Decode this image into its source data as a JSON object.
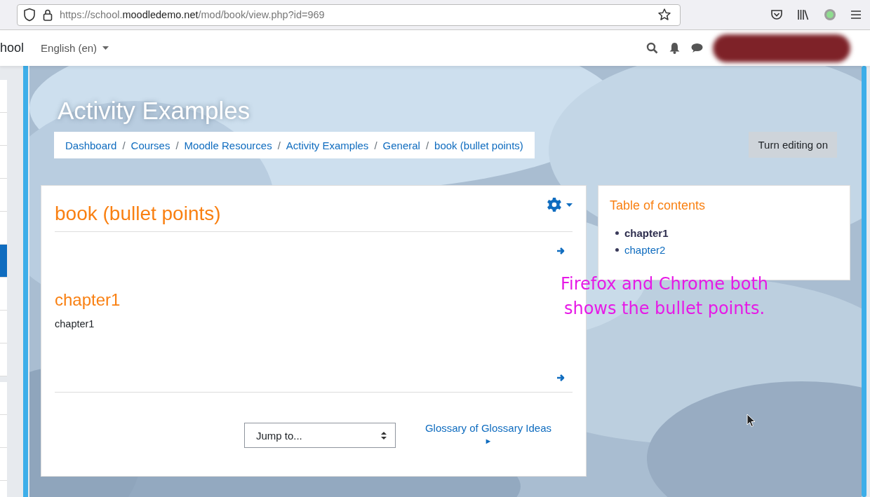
{
  "browser": {
    "url": {
      "prefix": "https://school.",
      "host": "moodledemo.net",
      "path": "/mod/book/view.php?id=969"
    }
  },
  "navbar": {
    "site_name": "hool",
    "language": "English (en)"
  },
  "sidebar": {
    "items": [
      {
        "selected": false
      },
      {
        "selected": false
      },
      {
        "selected": false
      },
      {
        "selected": false
      },
      {
        "selected": false
      },
      {
        "selected": true
      },
      {
        "selected": false
      },
      {
        "selected": false
      },
      {
        "selected": false
      },
      {
        "selected": false
      },
      {
        "selected": false
      },
      {
        "selected": false
      },
      {
        "selected": false
      }
    ]
  },
  "page_header": {
    "title": "Activity Examples",
    "breadcrumb": [
      {
        "label": "Dashboard"
      },
      {
        "separator": "/",
        "label": "Courses"
      },
      {
        "separator": "/",
        "label": "Moodle Resources"
      },
      {
        "separator": "/",
        "label": "Activity Examples"
      },
      {
        "separator": "/",
        "label": "General"
      },
      {
        "separator": "/",
        "label": "book (bullet points)"
      }
    ],
    "edit_button": "Turn editing on"
  },
  "book": {
    "title": "book (bullet points)",
    "chapter_title": "chapter1",
    "chapter_text": "chapter1",
    "jump_select": "Jump to...",
    "next_link": "Glossary of Glossary Ideas",
    "next_arrow": "►"
  },
  "toc": {
    "title": "Table of contents",
    "items": [
      {
        "label": "chapter1",
        "selected": true
      },
      {
        "label": "chapter2",
        "selected": false
      }
    ]
  },
  "annotation": "Firefox and Chrome both shows the bullet points."
}
